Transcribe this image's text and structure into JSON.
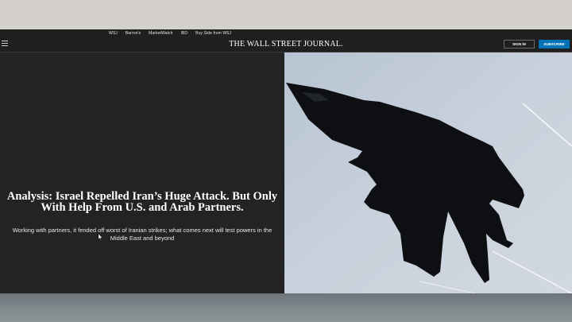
{
  "utility_nav": {
    "links": [
      "WSJ",
      "Barron's",
      "MarketWatch",
      "IBD",
      "Buy Side from WSJ"
    ]
  },
  "header": {
    "masthead": "THE WALL STREET JOURNAL.",
    "sign_in_label": "SIGN IN",
    "subscribe_label": "SUBSCRIBE"
  },
  "hero": {
    "headline": "Analysis: Israel Repelled Iran’s Huge Attack. But Only With Help From U.S. and Arab Partners.",
    "dek": "Working with partners, it fended off worst of Iranian strikes; what comes next will test powers in the Middle East and beyond"
  },
  "colors": {
    "page_bg": "#1f1f1f",
    "subscribe_accent": "#0274b6",
    "sky": "#c3cdd9"
  },
  "icons": [
    "menu-icon",
    "mouse-pointer-icon"
  ]
}
